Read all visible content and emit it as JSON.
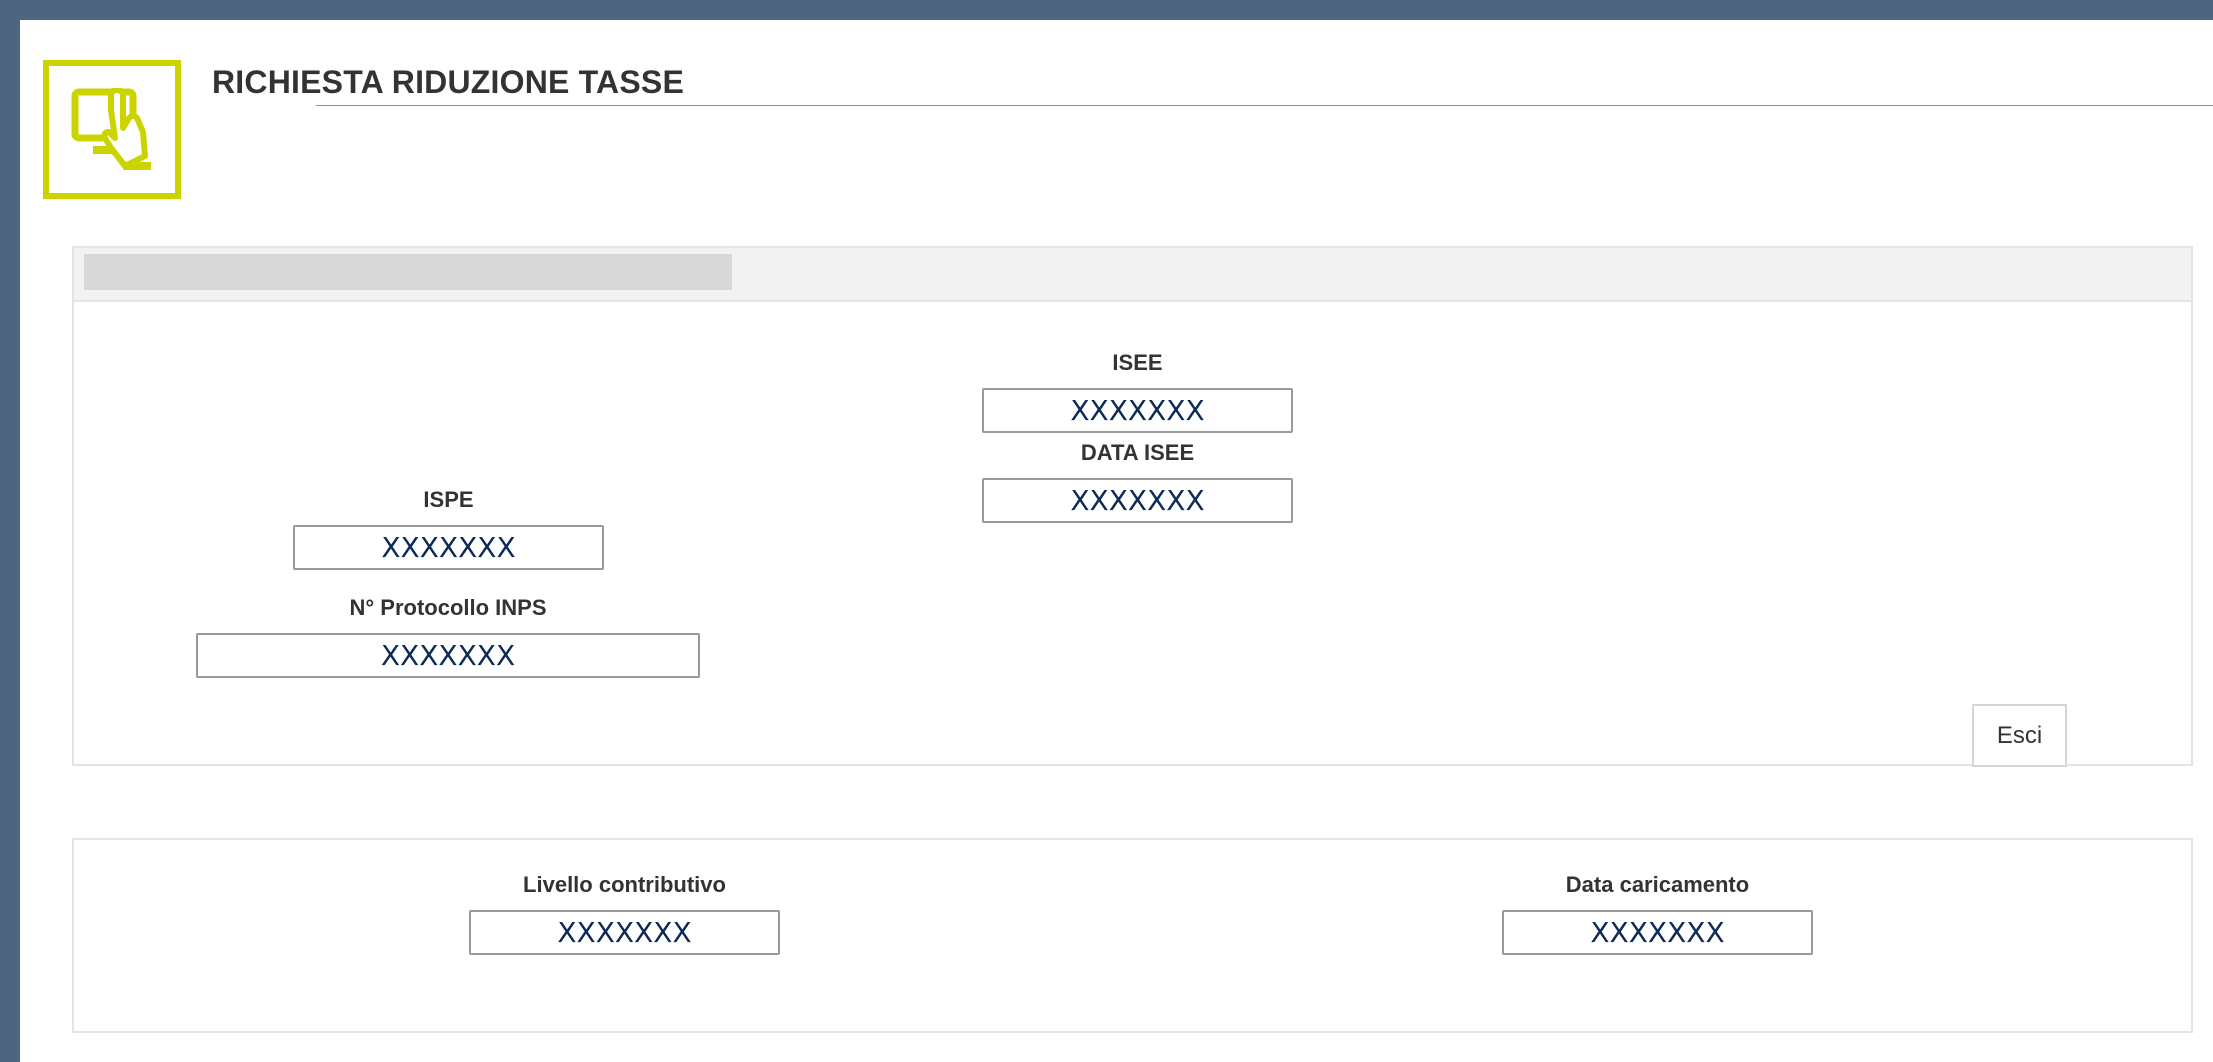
{
  "header": {
    "title": "RICHIESTA RIDUZIONE TASSE",
    "logo_icon": "touchscreen-hand-icon",
    "accent_color": "#ccd400"
  },
  "form": {
    "isee": {
      "label": "ISEE",
      "value": "XXXXXXX"
    },
    "data_isee": {
      "label": "DATA ISEE",
      "value": "XXXXXXX"
    },
    "ispe": {
      "label": "ISPE",
      "value": "XXXXXXX"
    },
    "protocollo": {
      "label": "N° Protocollo INPS",
      "value": "XXXXXXX"
    },
    "esci_label": "Esci"
  },
  "bottom": {
    "livello": {
      "label": "Livello contributivo",
      "value": "XXXXXXX"
    },
    "data_caricamento": {
      "label": "Data caricamento",
      "value": "XXXXXXX"
    }
  }
}
